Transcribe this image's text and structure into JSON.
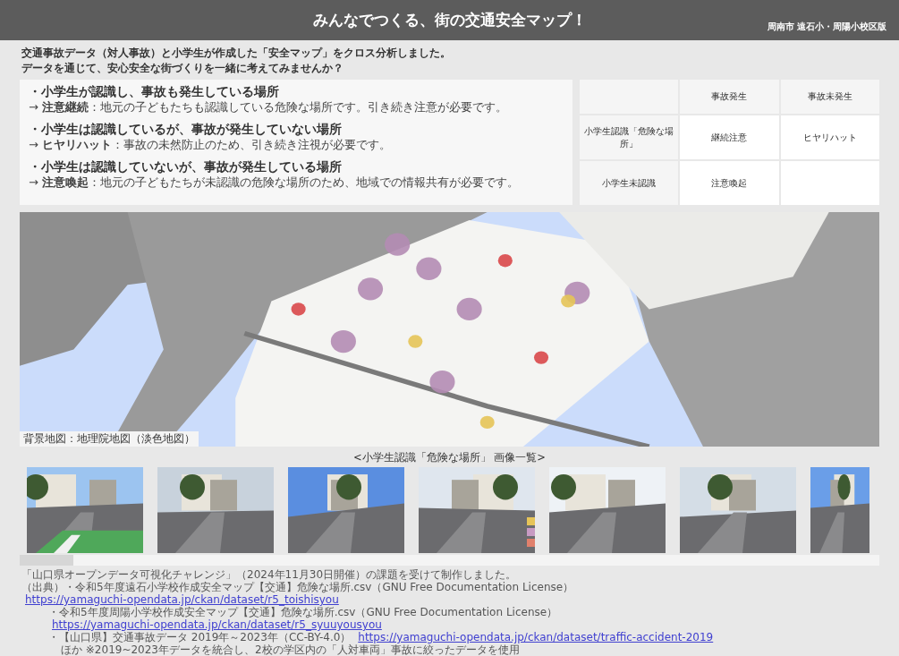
{
  "header": {
    "title": "みんなでつくる、街の交通安全マップ！",
    "subtitle": "周南市 遠石小・周陽小校区版"
  },
  "intro": [
    "交通事故データ（対人事故）と小学生が作成した「安全マップ」をクロス分析しました。",
    "データを通じて、安心安全な街づくりを一緒に考えてみませんか？"
  ],
  "categories": [
    {
      "heading": "・小学生が認識し、事故も発生している場所",
      "note": "→ **注意継続**：地元の子どもたちも認識している危険な場所です。引き続き注意が必要です。"
    },
    {
      "heading": "・小学生は認識しているが、事故が発生していない場所",
      "note": "→ **ヒヤリハット**：事故の未然防止のため、引き続き注視が必要です。"
    },
    {
      "heading": "・小学生は認識していないが、事故が発生している場所",
      "note": "→ **注意喚起**：地元の子どもたちが未認識の危険な場所のため、地域での情報共有が必要です。"
    }
  ],
  "table": {
    "columns": [
      "事故発生",
      "事故未発生"
    ],
    "rows": [
      {
        "header": "小学生認識「危険な場所」",
        "cells": [
          "継続注意",
          "ヒヤリハット"
        ]
      },
      {
        "header": "小学生未認識",
        "cells": [
          "注意喚起"
        ]
      }
    ]
  },
  "map": {
    "kind": "picture",
    "caption": "背景地図：地理院地図（淡色地図）"
  },
  "gallery": {
    "title": "<小学生認識「危険な場所」 画像一覧>",
    "legend": [
      {
        "color": "#e6c458"
      },
      {
        "color": "#c79ac2"
      },
      {
        "color": "#e0806c"
      }
    ]
  },
  "footer": [
    {
      "text": "「山口県オープンデータ可視化チャレンジ」（2024年11月30日開催）の課題を受けて制作しました。"
    },
    {
      "text": "（出典）・令和5年度遠石小学校作成安全マップ【交通】危険な場所.csv（GNU Free Documentation License）",
      "link": "https://yamaguchi-opendata.jp/ckan/dataset/r5_toishisyou"
    },
    {
      "text": "・令和5年度周陽小学校作成安全マップ【交通】危険な場所.csv（GNU Free Documentation License）",
      "link": "https://yamaguchi-opendata.jp/ckan/dataset/r5_syuuyousyou",
      "indent": true
    },
    {
      "text": "・【山口県】交通事故データ 2019年～2023年（CC-BY-4.0）",
      "link": "https://yamaguchi-opendata.jp/ckan/dataset/traffic-accident-2019",
      "after": "ほか ※2019~2023年データを統合し、2校の学区内の「人対車両」事故に絞ったデータを使用",
      "indent": true
    }
  ]
}
